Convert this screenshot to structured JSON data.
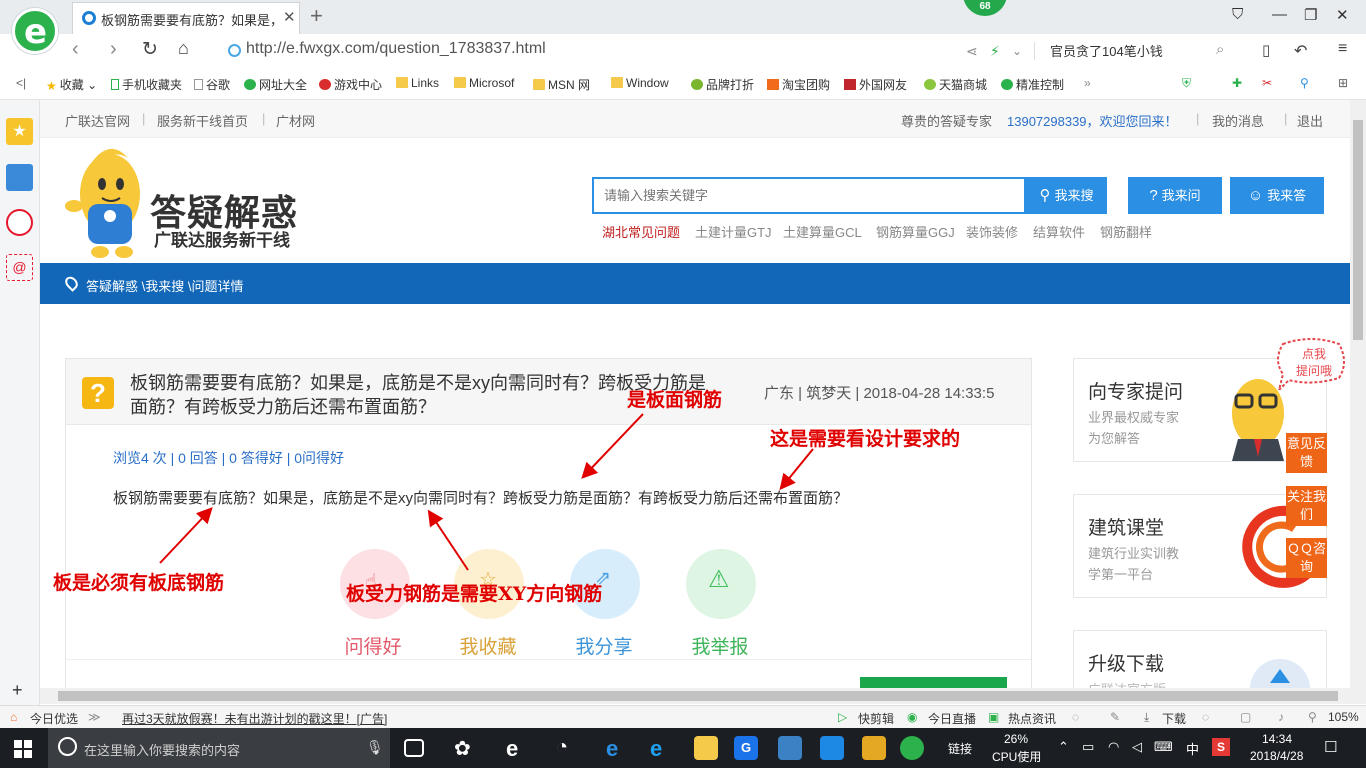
{
  "browser": {
    "tab_title": "板钢筋需要要有底筋？如果是，底",
    "counter_badge": "68",
    "url": "http://e.fwxgx.com/question_1783837.html",
    "search_text": "官员贪了104笔小钱"
  },
  "bookmarks": [
    "收藏",
    "手机收藏夹",
    "谷歌",
    "网址大全",
    "游戏中心",
    "Links",
    "Microsof",
    "MSN 网",
    "Window",
    "品牌打折",
    "淘宝团购",
    "外国网友",
    "天猫商城",
    "精准控制"
  ],
  "topnav": {
    "links": [
      "广联达官网",
      "服务新干线首页",
      "广材网"
    ],
    "expert": "尊贵的答疑专家",
    "welcome": "13907298339，欢迎您回来！",
    "messages": "我的消息",
    "logout": "退出"
  },
  "header": {
    "logo_title": "答疑解惑",
    "logo_subtitle": "广联达服务新干线",
    "search_placeholder": "请输入搜索关键字",
    "btn_search": "我来搜",
    "btn_ask": "我来问",
    "btn_answer": "我来答",
    "hot_keywords": [
      "湖北常见问题",
      "土建计量GTJ",
      "土建算量GCL",
      "钢筋算量GGJ",
      "装饰装修",
      "结算软件",
      "钢筋翻样"
    ]
  },
  "breadcrumb": "答疑解惑 \\我来搜 \\问题详情",
  "question": {
    "title": "板钢筋需要要有底筋？如果是，底筋是不是xy向需同时有？跨板受力筋是面筋？有跨板受力筋后还需布置面筋？",
    "meta": "广东 | 筑梦天 | 2018-04-28 14:33:5",
    "stats": "浏览4 次 | 0 回答 | 0 答得好 | 0问得好",
    "body": "板钢筋需要要有底筋？如果是，底筋是不是xy向需同时有？跨板受力筋是面筋？有跨板受力筋后还需布置面筋？",
    "actions": [
      "问得好",
      "我收藏",
      "我分享",
      "我举报"
    ]
  },
  "annotations": {
    "top_rebar": "是板面钢筋",
    "design": "这是需要看设计要求的",
    "bottom_rebar": "板是必须有板底钢筋",
    "xy_rebar": "板受力钢筋是需要XY方向钢筋"
  },
  "sidebar": {
    "ask_title": "向专家提问",
    "ask_sub": [
      "业界最权威专家",
      "为您解答"
    ],
    "bubble": [
      "点我",
      "提问哦"
    ],
    "class_title": "建筑课堂",
    "class_sub": [
      "建筑行业实训教",
      "学第一平台"
    ],
    "download_title": "升级下载",
    "download_sub": "广联达官方版",
    "float_buttons": [
      "意见反馈",
      "关注我们",
      "ＱＱ咨询"
    ]
  },
  "statusbar": {
    "left": "今日优选",
    "ad": "再过3天就放假赛！未有出游计划的戳这里！[广告]",
    "items": [
      "快剪辑",
      "今日直播",
      "热点资讯",
      "下载"
    ],
    "zoom": "105%"
  },
  "taskbar": {
    "search_placeholder": "在这里输入你要搜索的内容",
    "link_label": "链接",
    "cpu_percent": "26%",
    "cpu_label": "CPU使用",
    "ime": "中",
    "time": "14:34",
    "date": "2018/4/28"
  },
  "colors": {
    "brand_blue": "#1267b8",
    "button_blue": "#2b8fe3",
    "annotation_red": "#e00000",
    "float_orange": "#ef6517"
  }
}
